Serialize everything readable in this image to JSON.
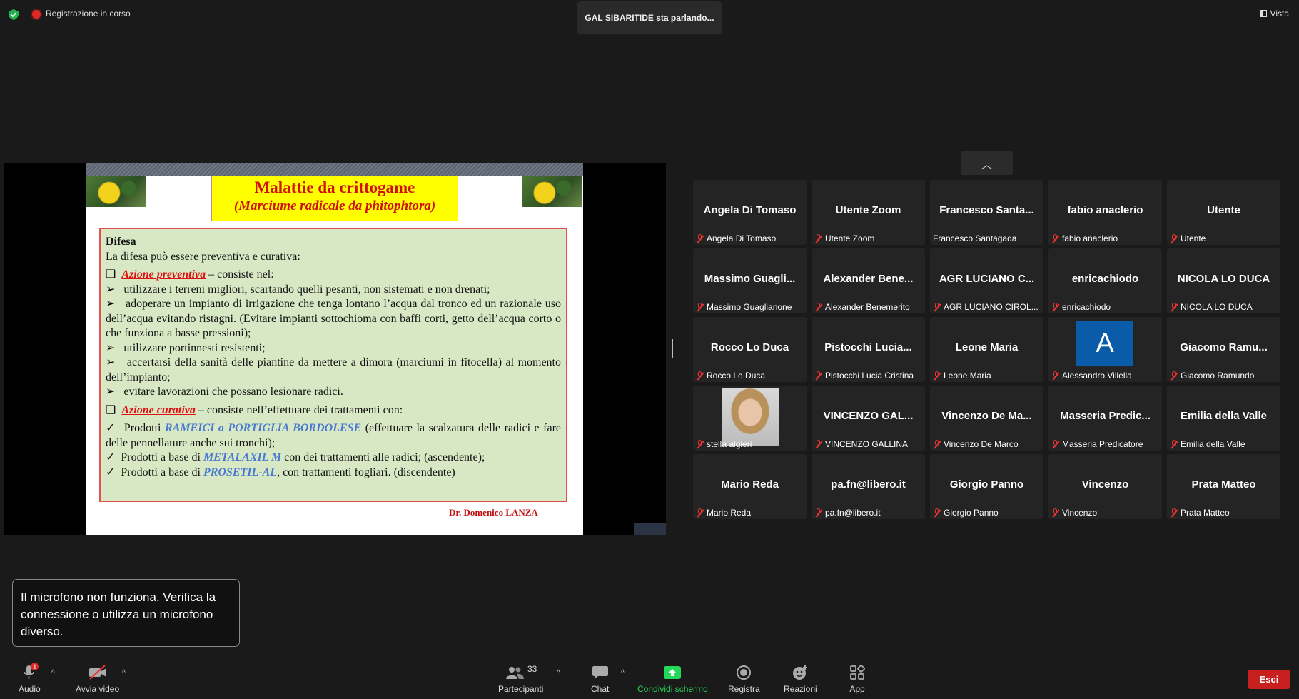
{
  "topbar": {
    "recording_text": "Registrazione in corso",
    "speaking_text": "GAL SIBARITIDE sta parlando...",
    "view_label": "Vista"
  },
  "slide": {
    "title": "Malattie da crittogame",
    "subtitle": "(Marciume radicale da phitophtora)",
    "heading": "Difesa",
    "intro": "La difesa può essere preventiva e curativa:",
    "prev_bullet": "❑",
    "prev_label": "Azione preventiva",
    "prev_text": " – consiste nel:",
    "arrow": "➢",
    "p1": "utilizzare i terreni migliori,  scartando quelli pesanti, non sistemati e non drenati;",
    "p2": "adoperare un impianto di irrigazione che tenga lontano l’acqua dal tronco ed un razionale uso dell’acqua evitando ristagni. (Evitare impianti sottochioma con baffi corti, getto dell’acqua corto o che funziona a basse pressioni);",
    "p3": "utilizzare portinnesti resistenti;",
    "p4": "accertarsi della sanità delle piantine da mettere a dimora (marciumi in fitocella) al momento dell’impianto;",
    "p5": "evitare lavorazioni che possano lesionare radici.",
    "cur_bullet": "❑",
    "cur_label": "Azione curativa",
    "cur_text": " – consiste nell’effettuare dei trattamenti con:",
    "check": "✓",
    "c1_pre": "Prodotti ",
    "c1_blue": "RAMEICI o PORTIGLIA BORDOLESE",
    "c1_post": " (effettuare la scalzatura delle radici e fare delle pennellature anche sui tronchi);",
    "c2_pre": "Prodotti a base di ",
    "c2_blue": "METALAXIL M",
    "c2_post": " con dei trattamenti alle radici; (ascendente);",
    "c3_pre": "Prodotti a base di ",
    "c3_blue": "PROSETIL-AL",
    "c3_post": ", con trattamenti fogliari.  (discendente)",
    "author": "Dr. Domenico LANZA"
  },
  "gallery": {
    "collapse_icon": "chevron-up-icon",
    "collapse_glyph": "︿",
    "tiles": [
      {
        "name": "Angela Di Tomaso",
        "label": "Angela Di Tomaso",
        "muted": true
      },
      {
        "name": "Utente Zoom",
        "label": "Utente Zoom",
        "muted": true
      },
      {
        "name": "Francesco  Santa...",
        "label": "Francesco Santagada",
        "muted": false
      },
      {
        "name": "fabio anaclerio",
        "label": "fabio anaclerio",
        "muted": true
      },
      {
        "name": "Utente",
        "label": "Utente",
        "muted": true
      },
      {
        "name": "Massimo  Guagli...",
        "label": "Massimo Guaglianone",
        "muted": true
      },
      {
        "name": "Alexander  Bene...",
        "label": "Alexander Benemerito",
        "muted": true
      },
      {
        "name": "AGR LUCIANO C...",
        "label": "AGR LUCIANO CIROL...",
        "muted": true
      },
      {
        "name": "enricachiodo",
        "label": "enricachiodo",
        "muted": true
      },
      {
        "name": "NICOLA LO DUCA",
        "label": "NICOLA LO DUCA",
        "muted": true
      },
      {
        "name": "Rocco Lo Duca",
        "label": "Rocco Lo Duca",
        "muted": true
      },
      {
        "name": "Pistocchi  Lucia...",
        "label": "Pistocchi Lucia Cristina",
        "muted": true
      },
      {
        "name": "Leone Maria",
        "label": "Leone Maria",
        "muted": true
      },
      {
        "name": "A",
        "label": "Alessandro Villella",
        "muted": true
      },
      {
        "name": "Giacomo  Ramu...",
        "label": "Giacomo Ramundo",
        "muted": true
      },
      {
        "name": "",
        "label": "stella algieri",
        "muted": true
      },
      {
        "name": "VINCENZO  GAL...",
        "label": "VINCENZO GALLINA",
        "muted": true
      },
      {
        "name": "Vincenzo  De  Ma...",
        "label": "Vincenzo De Marco",
        "muted": true
      },
      {
        "name": "Masseria  Predic...",
        "label": "Masseria Predicatore",
        "muted": true
      },
      {
        "name": "Emilia della Valle",
        "label": "Emilia della Valle",
        "muted": true
      },
      {
        "name": "Mario Reda",
        "label": "Mario Reda",
        "muted": true
      },
      {
        "name": "pa.fn@libero.it",
        "label": "pa.fn@libero.it",
        "muted": true
      },
      {
        "name": "Giorgio Panno",
        "label": "Giorgio Panno",
        "muted": true
      },
      {
        "name": "Vincenzo",
        "label": "Vincenzo",
        "muted": true
      },
      {
        "name": "Prata Matteo",
        "label": "Prata Matteo",
        "muted": true
      }
    ]
  },
  "toast": {
    "text": "Il microfono non funziona. Verifica la connessione o utilizza un microfono diverso."
  },
  "toolbar": {
    "audio": "Audio",
    "audio_badge": "!",
    "video": "Avvia video",
    "participants": "Partecipanti",
    "participants_count": "33",
    "chat": "Chat",
    "share": "Condividi schermo",
    "record": "Registra",
    "reactions": "Reazioni",
    "apps": "App",
    "leave": "Esci",
    "caret": "^"
  },
  "colors": {
    "share_green": "#23d959",
    "leave_red": "#c81f1f",
    "muted_red": "#e33333",
    "avatar_blue": "#0b5ca8"
  }
}
